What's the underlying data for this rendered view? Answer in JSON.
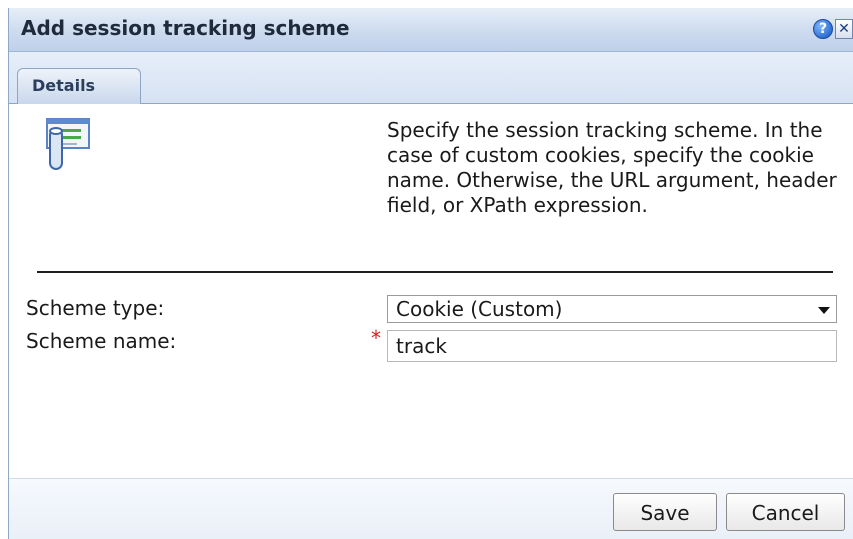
{
  "dialog": {
    "title": "Add session tracking scheme",
    "help_icon": "?",
    "close_icon": "✕"
  },
  "tabs": [
    {
      "label": "Details"
    }
  ],
  "details": {
    "icon": "session-tracking-icon",
    "description": "Specify the session tracking scheme. In the case of custom cookies, specify the cookie name. Otherwise, the URL argument, header field, or XPath expression."
  },
  "form": {
    "scheme_type_label": "Scheme type:",
    "scheme_type_value": "Cookie (Custom)",
    "scheme_name_label": "Scheme name:",
    "required_marker": "*",
    "scheme_name_value": "track"
  },
  "buttons": {
    "save": "Save",
    "cancel": "Cancel"
  },
  "colors": {
    "title_bar": "#cddbef",
    "required": "#d22020",
    "tab_border": "#8ea5c6"
  }
}
